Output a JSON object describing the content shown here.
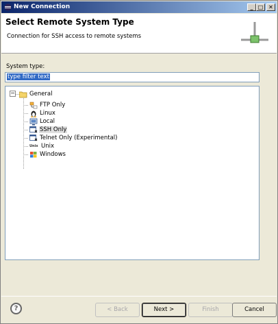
{
  "window": {
    "title": "New Connection",
    "controls": {
      "minimize": "_",
      "maximize": "□",
      "close": "✕"
    }
  },
  "header": {
    "title": "Select Remote System Type",
    "description": "Connection for SSH access to remote systems"
  },
  "filter": {
    "label": "System type:",
    "value": "type filter text"
  },
  "tree": {
    "root": {
      "label": "General",
      "expander": "−"
    },
    "items": [
      {
        "label": "FTP Only",
        "icon": "ftp-icon"
      },
      {
        "label": "Linux",
        "icon": "linux-icon"
      },
      {
        "label": "Local",
        "icon": "local-icon"
      },
      {
        "label": "SSH Only",
        "icon": "ssh-icon",
        "selected": true
      },
      {
        "label": "Telnet Only (Experimental)",
        "icon": "telnet-icon"
      },
      {
        "label": "Unix",
        "icon": "unix-icon",
        "icon_text": "Unix"
      },
      {
        "label": "Windows",
        "icon": "windows-icon"
      }
    ]
  },
  "buttons": {
    "help": "?",
    "back": "< Back",
    "next": "Next >",
    "finish": "Finish",
    "cancel": "Cancel"
  }
}
